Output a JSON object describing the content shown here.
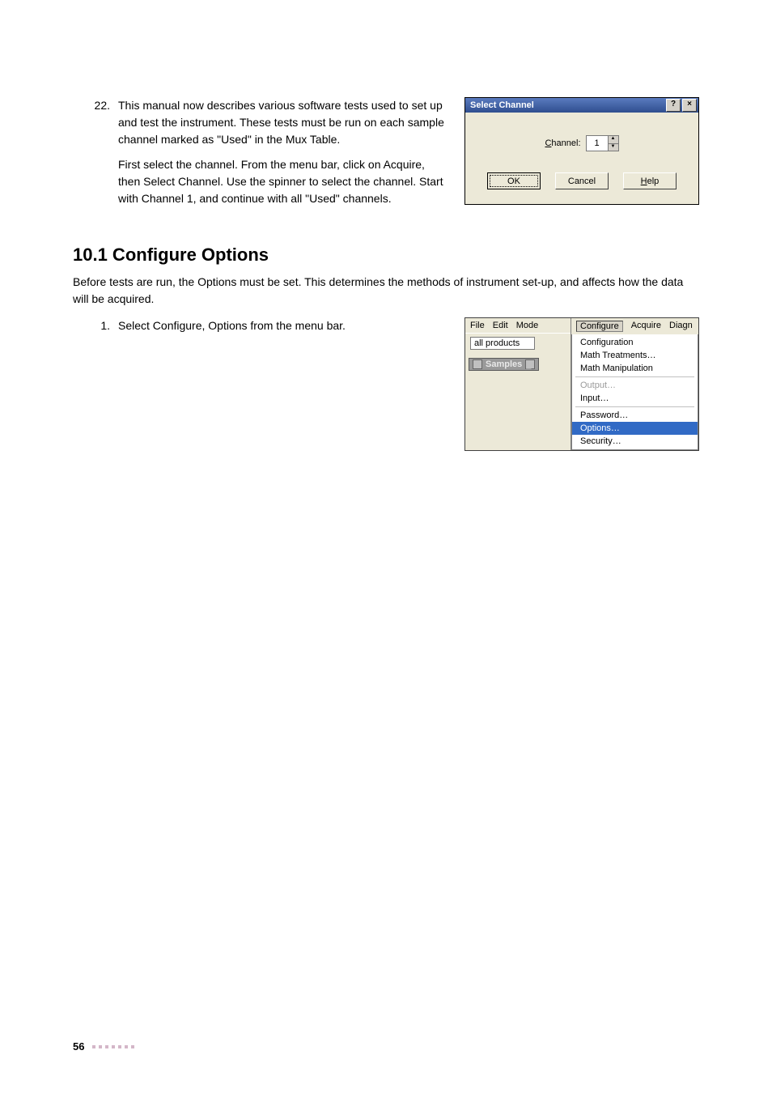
{
  "list1": {
    "num": "22.",
    "p1": "This manual now describes various software tests used to set up and test the instrument. These tests must be run on each sample channel marked as \"Used\" in the Mux Table.",
    "p2": "First select the channel. From the menu bar, click on Acquire, then Select Channel. Use the spinner to select the channel. Start with Channel 1, and continue with all \"Used\" channels."
  },
  "dialog": {
    "title": "Select Channel",
    "help_btn": "?",
    "close_btn": "×",
    "channel_label_pre": "C",
    "channel_label_post": "hannel:",
    "channel_value": "1",
    "ok": "OK",
    "cancel": "Cancel",
    "help_pre": "H",
    "help_post": "elp"
  },
  "section": {
    "heading": "10.1  Configure Options",
    "para": "Before tests are run, the Options must be set. This determines the methods of instrument set-up, and affects how the data will be acquired."
  },
  "list2": {
    "num": "1.",
    "p1": "Select Configure, Options from the menu bar."
  },
  "menu": {
    "left_items": [
      "File",
      "Edit",
      "Mode"
    ],
    "right_items": [
      "Configure",
      "Acquire",
      "Diagn"
    ],
    "toolbar_field": "all products",
    "samples_tab": "Samples",
    "dropdown": {
      "g1": [
        "Configuration",
        "Math Treatments…",
        "Math Manipulation"
      ],
      "g2_disabled": "Output…",
      "g2b": "Input…",
      "g3": "Password…",
      "g4_selected": "Options…",
      "g5": "Security…"
    }
  },
  "footer": {
    "page": "56"
  }
}
